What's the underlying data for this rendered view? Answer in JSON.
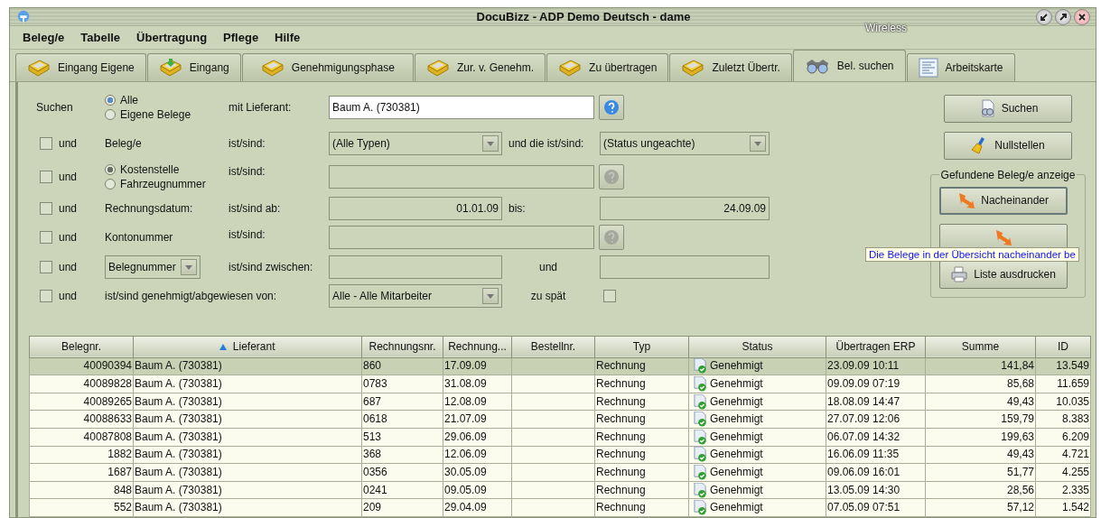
{
  "window": {
    "title": "DocuBizz - ADP Demo Deutsch - dame",
    "overlay_label": "Wireless"
  },
  "menu": [
    "Beleg/e",
    "Tabelle",
    "Übertragung",
    "Pflege",
    "Hilfe"
  ],
  "tabs": [
    {
      "label": "Eingang Eigene",
      "kind": "tray",
      "selected": false
    },
    {
      "label": "Eingang",
      "kind": "incoming",
      "selected": false
    },
    {
      "label": "Genehmigungsphase",
      "kind": "tray",
      "selected": false
    },
    {
      "label": "Zur. v. Genehm.",
      "kind": "tray",
      "selected": false
    },
    {
      "label": "Zu übertragen",
      "kind": "tray",
      "selected": false
    },
    {
      "label": "Zuletzt Übertr.",
      "kind": "tray",
      "selected": false
    },
    {
      "label": "Bel. suchen",
      "kind": "search",
      "selected": true
    },
    {
      "label": "Arbeitskarte",
      "kind": "card",
      "selected": false
    }
  ],
  "search": {
    "label": "Suchen",
    "scope": [
      {
        "label": "Alle",
        "selected": true
      },
      {
        "label": "Eigene Belege",
        "selected": false
      }
    ],
    "operator": "mit Lieferant:",
    "supplier": "Baum A. (730381)",
    "help_disabled": false
  },
  "filters": [
    {
      "checked": false,
      "conjunction": "und",
      "label": "Beleg/e",
      "operator": "ist/sind:",
      "select": "(Alle Typen)",
      "operator_2": "und die ist/sind:",
      "select_2": "(Status ungeachte)"
    },
    {
      "checked": false,
      "conjunction": "und",
      "options": [
        {
          "label": "Kostenstelle",
          "selected": true
        },
        {
          "label": "Fahrzeugnummer",
          "selected": false
        }
      ],
      "operator": "ist/sind:",
      "help_disabled": true
    },
    {
      "checked": false,
      "conjunction": "und",
      "label": "Rechnungsdatum:",
      "operator": "ist/sind ab:",
      "from": "01.01.09",
      "operator_2": "bis:",
      "to": "24.09.09"
    },
    {
      "checked": false,
      "conjunction": "und",
      "label": "Kontonummer",
      "operator": "ist/sind:",
      "help_disabled": true
    },
    {
      "checked": false,
      "conjunction": "und",
      "select": "Belegnummer",
      "operator": "ist/sind zwischen:",
      "operator_2": "und"
    },
    {
      "checked": false,
      "conjunction": "und",
      "label": "ist/sind genehmigt/abgewiesen von:",
      "select": "Alle - Alle Mitarbeiter",
      "operator_2": "zu spät",
      "late_checked": false
    }
  ],
  "actions": {
    "buttons": [
      {
        "label": "Suchen",
        "kind": "search"
      },
      {
        "label": "Nullstellen",
        "kind": "reset"
      }
    ],
    "group_title": "Gefundene Beleg/e anzeige",
    "group_buttons": [
      {
        "label": "Nacheinander",
        "kind": "sequence",
        "focused": true
      },
      {
        "kind": "sequence",
        "focused": false
      },
      {
        "label": "Liste ausdrucken",
        "kind": "print",
        "focused": false
      }
    ]
  },
  "tooltip": "Die Belege in der Übersicht nacheinander be",
  "table": {
    "columns": [
      {
        "label": "Belegnr.",
        "sorted": false
      },
      {
        "label": "Lieferant",
        "sorted": true
      },
      {
        "label": "Rechnungsnr.",
        "sorted": false
      },
      {
        "label": "Rechnung...",
        "sorted": false
      },
      {
        "label": "Bestellnr.",
        "sorted": false
      },
      {
        "label": "Typ",
        "sorted": false
      },
      {
        "label": "Status",
        "sorted": false
      },
      {
        "label": "Übertragen ERP",
        "sorted": false
      },
      {
        "label": "Summe",
        "sorted": false
      },
      {
        "label": "ID",
        "sorted": false
      }
    ],
    "rows": [
      {
        "selected": true,
        "approved": true,
        "cells": [
          "40090394",
          "Baum A. (730381)",
          "860",
          "17.09.09",
          null,
          "Rechnung",
          "Genehmigt",
          "23.09.09 10:11",
          "141,84",
          "13.549"
        ]
      },
      {
        "selected": false,
        "approved": true,
        "cells": [
          "40089828",
          "Baum A. (730381)",
          "0783",
          "31.08.09",
          null,
          "Rechnung",
          "Genehmigt",
          "09.09.09 07:19",
          "85,68",
          "11.659"
        ]
      },
      {
        "selected": false,
        "approved": true,
        "cells": [
          "40089265",
          "Baum A. (730381)",
          "687",
          "12.08.09",
          null,
          "Rechnung",
          "Genehmigt",
          "18.08.09 14:47",
          "49,43",
          "10.035"
        ]
      },
      {
        "selected": false,
        "approved": true,
        "cells": [
          "40088633",
          "Baum A. (730381)",
          "0618",
          "21.07.09",
          null,
          "Rechnung",
          "Genehmigt",
          "27.07.09 12:06",
          "159,79",
          "8.383"
        ]
      },
      {
        "selected": false,
        "approved": true,
        "cells": [
          "40087808",
          "Baum A. (730381)",
          "513",
          "29.06.09",
          null,
          "Rechnung",
          "Genehmigt",
          "06.07.09 14:32",
          "199,63",
          "6.209"
        ]
      },
      {
        "selected": false,
        "approved": true,
        "cells": [
          "1882",
          "Baum A. (730381)",
          "368",
          "12.06.09",
          null,
          "Rechnung",
          "Genehmigt",
          "16.06.09 11:35",
          "49,43",
          "4.721"
        ]
      },
      {
        "selected": false,
        "approved": true,
        "cells": [
          "1687",
          "Baum A. (730381)",
          "0356",
          "30.05.09",
          null,
          "Rechnung",
          "Genehmigt",
          "09.06.09 16:01",
          "51,77",
          "4.255"
        ]
      },
      {
        "selected": false,
        "approved": true,
        "cells": [
          "848",
          "Baum A. (730381)",
          "0241",
          "09.05.09",
          null,
          "Rechnung",
          "Genehmigt",
          "13.05.09 14:30",
          "28,56",
          "2.335"
        ]
      },
      {
        "selected": false,
        "approved": true,
        "cells": [
          "552",
          "Baum A. (730381)",
          "209",
          "29.04.09",
          null,
          "Rechnung",
          "Genehmigt",
          "07.05.09 07:51",
          "57,12",
          "1.542"
        ]
      }
    ]
  }
}
